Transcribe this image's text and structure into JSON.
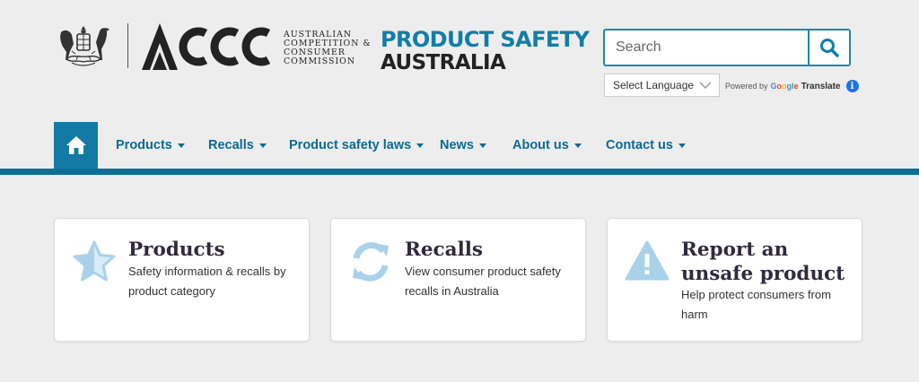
{
  "header": {
    "accc_wordmark": "ACCC",
    "accc_name": "AUSTRALIAN COMPETITION & CONSUMER COMMISSION",
    "site_title_line1": "PRODUCT SAFETY",
    "site_title_line2": "AUSTRALIA"
  },
  "search": {
    "placeholder": "Search",
    "icon": "search-icon"
  },
  "translate": {
    "select_label": "Select Language",
    "powered_by": "Powered by",
    "google": "Google",
    "translate": "Translate",
    "info": "i"
  },
  "nav": {
    "home_icon": "home-icon",
    "items": [
      {
        "label": "Products"
      },
      {
        "label": "Recalls"
      },
      {
        "label": "Product safety laws"
      },
      {
        "label": "News"
      },
      {
        "label": "About us"
      },
      {
        "label": "Contact us"
      }
    ]
  },
  "cards": [
    {
      "title": "Products",
      "description": "Safety information & recalls by product category",
      "icon": "star-icon"
    },
    {
      "title": "Recalls",
      "description": "View consumer product safety recalls in Australia",
      "icon": "refresh-icon"
    },
    {
      "title": "Report an unsafe product",
      "description": "Help protect consumers from harm",
      "icon": "warning-icon"
    }
  ],
  "colors": {
    "brand_blue": "#117ea6",
    "nav_text": "#0d6a91",
    "nav_bar": "#0e6f95",
    "icon_light": "#b7d9ee",
    "background": "#ededed"
  }
}
